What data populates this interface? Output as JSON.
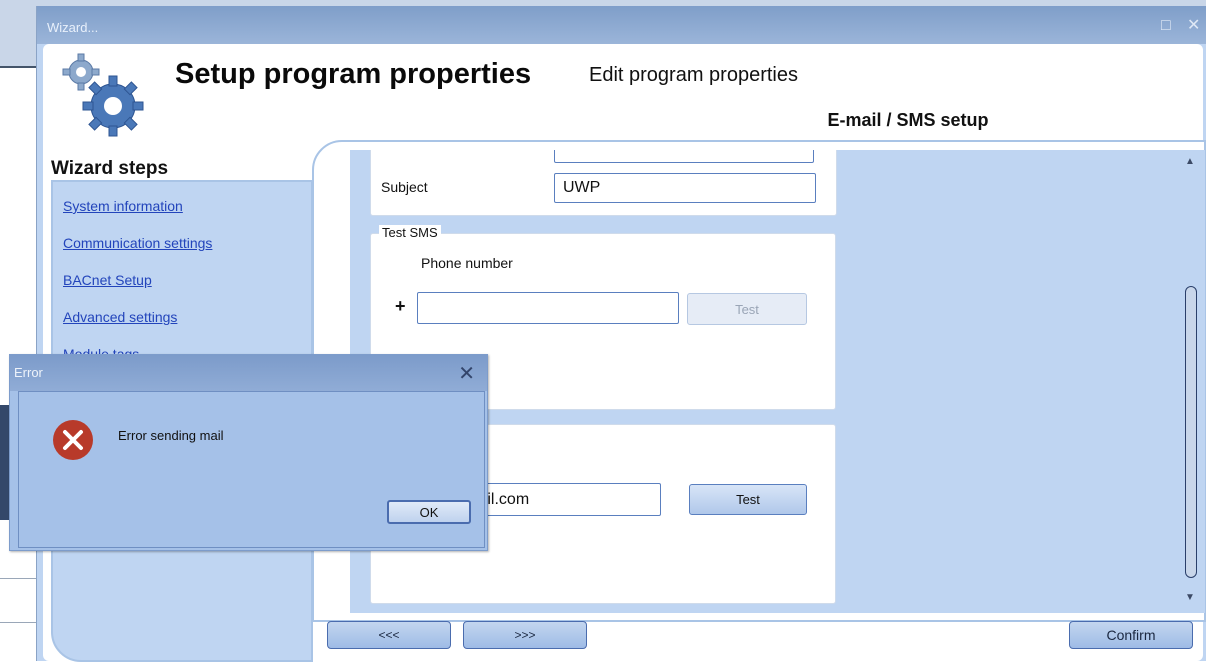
{
  "window": {
    "title": "Wizard..."
  },
  "header": {
    "title": "Setup program properties",
    "subtitle": "Edit program properties",
    "active_tab": "E-mail / SMS setup"
  },
  "sidebar": {
    "title": "Wizard steps",
    "items": [
      {
        "label": "System information"
      },
      {
        "label": "Communication settings"
      },
      {
        "label": "BACnet Setup"
      },
      {
        "label": "Advanced settings"
      },
      {
        "label": "Module tags"
      }
    ]
  },
  "form": {
    "subject_label": "Subject",
    "subject_value": "UWP",
    "test_sms": {
      "legend": "Test SMS",
      "phone_label": "Phone number",
      "plus": "+",
      "phone_value": "",
      "test_button": "Test"
    },
    "test_email": {
      "email_value": "@gmail.com",
      "test_button": "Test"
    }
  },
  "nav": {
    "back": "<<<",
    "next": ">>>",
    "confirm": "Confirm"
  },
  "error_dialog": {
    "title": "Error",
    "message": "Error sending mail",
    "ok": "OK"
  },
  "colors": {
    "wizard_background": "#bfd5f2",
    "titlebar": "#8aa7cf",
    "link": "#2244bb",
    "error_icon": "#b83a2a"
  },
  "icons": {
    "logo": "gears-logo",
    "error": "error-x-icon",
    "close": "close-icon",
    "maximize": "maximize-icon"
  }
}
